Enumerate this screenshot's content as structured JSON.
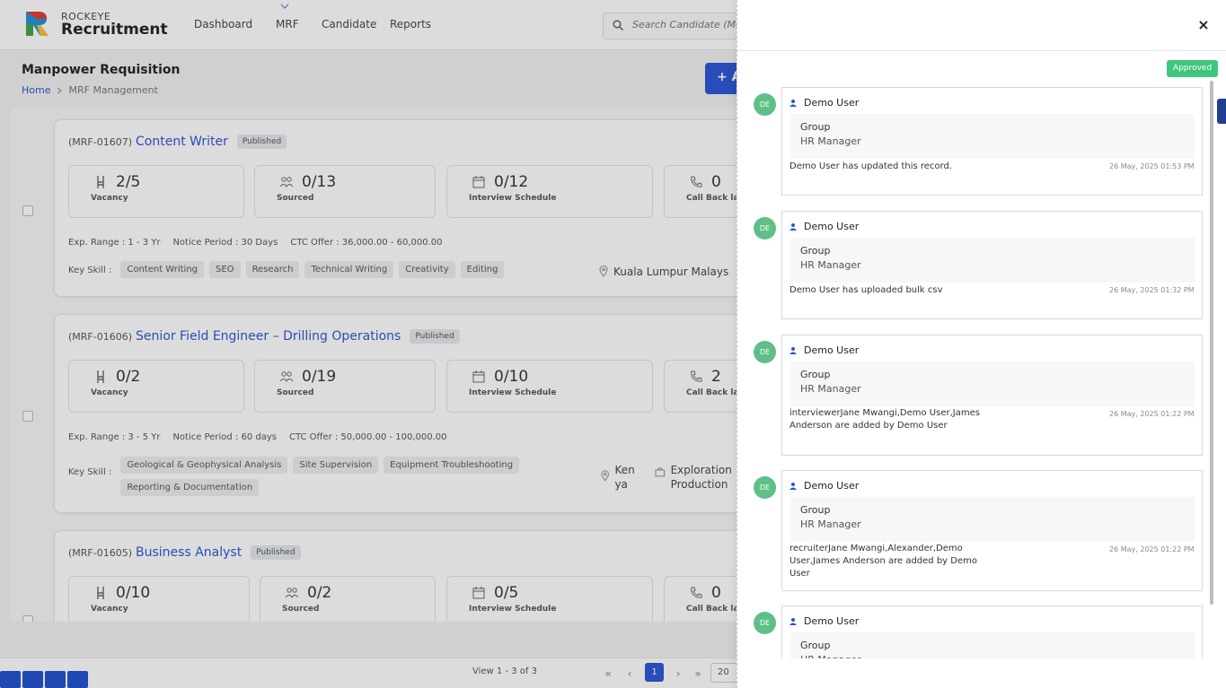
{
  "app": {
    "brand_top": "ROCKEYE",
    "brand_main": "Recruitment",
    "nav": [
      "Dashboard",
      "MRF",
      "Candidate",
      "Reports"
    ],
    "search_placeholder": "Search Candidate (Mo"
  },
  "page": {
    "title": "Manpower Requisition",
    "breadcrumb_home": "Home",
    "breadcrumb_current": "MRF Management",
    "add_button": "+ A"
  },
  "cards": [
    {
      "code": "(MRF-01607)",
      "role": "Content Writer",
      "status": "Published",
      "stats": [
        {
          "value": "2/5",
          "label": "Vacancy"
        },
        {
          "value": "0/13",
          "label": "Sourced"
        },
        {
          "value": "0/12",
          "label": "Interview Schedule"
        },
        {
          "value": "0",
          "label": "Call Back la"
        }
      ],
      "exp": "Exp. Range : 1 - 3 Yr",
      "notice": "Notice Period : 30 Days",
      "ctc": "CTC Offer : 36,000.00 - 60,000.00",
      "key_skill_label": "Key Skill :",
      "skills": [
        "Content Writing",
        "SEO",
        "Research",
        "Technical Writing",
        "Creativity",
        "Editing"
      ],
      "location": "Kuala Lumpur Malays"
    },
    {
      "code": "(MRF-01606)",
      "role": "Senior Field Engineer – Drilling Operations",
      "status": "Published",
      "stats": [
        {
          "value": "0/2",
          "label": "Vacancy"
        },
        {
          "value": "0/19",
          "label": "Sourced"
        },
        {
          "value": "0/10",
          "label": "Interview Schedule"
        },
        {
          "value": "2",
          "label": "Call Back la"
        }
      ],
      "exp": "Exp. Range : 3 - 5 Yr",
      "notice": "Notice Period : 60 days",
      "ctc": "CTC Offer : 50,000.00 - 100,000.00",
      "key_skill_label": "Key Skill :",
      "skills": [
        "Geological & Geophysical Analysis",
        "Site Supervision",
        "Equipment Troubleshooting",
        "Reporting & Documentation"
      ],
      "location": "Ken ya",
      "department": "Exploration Production"
    },
    {
      "code": "(MRF-01605)",
      "role": "Business Analyst",
      "status": "Published",
      "stats": [
        {
          "value": "0/10",
          "label": "Vacancy"
        },
        {
          "value": "0/2",
          "label": "Sourced"
        },
        {
          "value": "0/5",
          "label": "Interview Schedule"
        },
        {
          "value": "0",
          "label": "Call Back la"
        }
      ]
    }
  ],
  "pagination": {
    "info": "View 1 - 3 of 3",
    "current": "1",
    "per_page": "20"
  },
  "drawer": {
    "close": "×",
    "status": "Approved",
    "entries": [
      {
        "avatar": "DE",
        "user": "Demo User",
        "group": "Group",
        "role": "HR Manager",
        "message": "Demo User has updated this record.",
        "date": "26 May, 2025 01:53 PM"
      },
      {
        "avatar": "DE",
        "user": "Demo User",
        "group": "Group",
        "role": "HR Manager",
        "message": "Demo User has uploaded bulk csv",
        "date": "26 May, 2025 01:32 PM"
      },
      {
        "avatar": "DE",
        "user": "Demo User",
        "group": "Group",
        "role": "HR Manager",
        "message": "interviewerJane Mwangi,Demo User,James Anderson are added by Demo User",
        "date": "26 May, 2025 01:22 PM"
      },
      {
        "avatar": "DE",
        "user": "Demo User",
        "group": "Group",
        "role": "HR Manager",
        "message": "recruiterJane Mwangi,Alexander,Demo User,James Anderson are added by Demo User",
        "date": "26 May, 2025 01:22 PM"
      },
      {
        "avatar": "DE",
        "user": "Demo User",
        "group": "Group",
        "role": "HR Manager",
        "message": "",
        "date": ""
      }
    ]
  }
}
